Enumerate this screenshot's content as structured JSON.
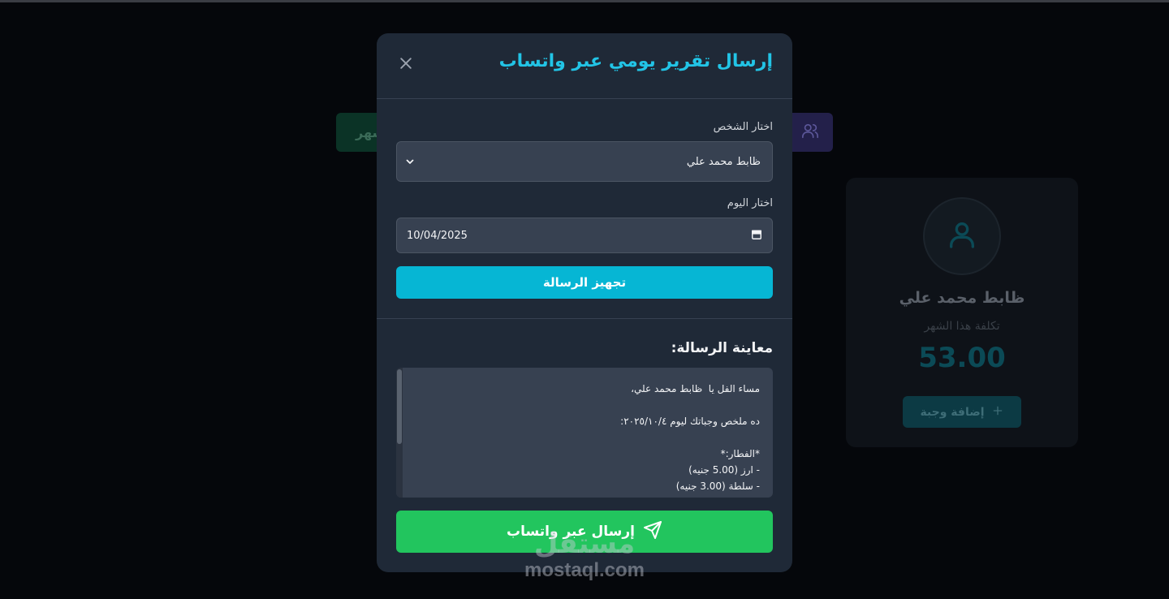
{
  "background": {
    "green_button_label": "شهر",
    "card": {
      "name": "ظابط محمد علي",
      "subtitle": "تكلفة هذا الشهر",
      "amount": "53.00",
      "add_button_label": "إضافة وجبة"
    }
  },
  "modal": {
    "title": "إرسال تقرير يومي عبر واتساب",
    "person_label": "اختار الشخص",
    "person_selected": "ظابط محمد علي",
    "day_label": "اختار اليوم",
    "date_value": "10/04/2025",
    "prepare_button_label": "تجهيز الرسالة",
    "preview_title": "معاينة الرسالة:",
    "preview_lines": [
      "مساء الفل يا  ظابط محمد علي،",
      "",
      "ده ملخص وجباتك ليوم ٢٠٢٥/١٠/٤:",
      "",
      "*الفطار:*",
      "- ارز (5.00 جنيه)",
      "- سلطة (3.00 جنيه)"
    ],
    "send_button_label": "إرسال عبر واتساب"
  },
  "watermark": {
    "arabic": "مستقل",
    "latin": "mostaql.com"
  },
  "colors": {
    "accent_cyan": "#06b6d4",
    "title_cyan": "#22c4e6",
    "send_green": "#22c55e",
    "modal_bg": "#1f2937"
  }
}
